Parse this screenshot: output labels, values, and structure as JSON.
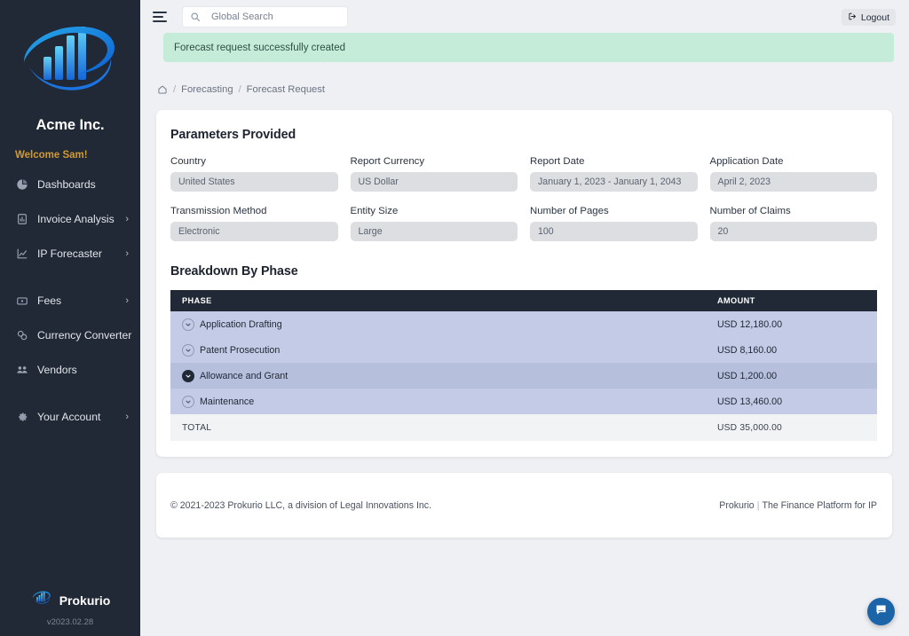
{
  "sidebar": {
    "company": "Acme Inc.",
    "welcome": "Welcome Sam!",
    "items": [
      {
        "label": "Dashboards",
        "icon": "pie-chart-icon",
        "chevron": ""
      },
      {
        "label": "Invoice Analysis",
        "icon": "document-chart-icon",
        "chevron": "›"
      },
      {
        "label": "IP Forecaster",
        "icon": "trend-chart-icon",
        "chevron": "›"
      },
      {
        "label": "Fees",
        "icon": "briefcase-icon",
        "chevron": "›"
      },
      {
        "label": "Currency Converter",
        "icon": "coins-icon",
        "chevron": ""
      },
      {
        "label": "Vendors",
        "icon": "people-icon",
        "chevron": ""
      },
      {
        "label": "Your Account",
        "icon": "gear-icon",
        "chevron": "›"
      }
    ],
    "footer_brand": "Prokurio",
    "version": "v2023.02.28"
  },
  "topbar": {
    "search_placeholder": "Global Search",
    "search_value": "",
    "logout_label": "Logout"
  },
  "alert": {
    "message": "Forecast request successfully created",
    "bg_color": "#c4ecd9"
  },
  "breadcrumb": {
    "home_icon": "home-icon",
    "sep": "/",
    "items": [
      "Forecasting",
      "Forecast Request"
    ]
  },
  "parameters": {
    "title": "Parameters Provided",
    "fields": [
      {
        "label": "Country",
        "value": "United States"
      },
      {
        "label": "Report Currency",
        "value": "US Dollar"
      },
      {
        "label": "Report Date",
        "value": "January 1, 2023 - January 1, 2043"
      },
      {
        "label": "Application Date",
        "value": "April 2, 2023"
      },
      {
        "label": "Transmission Method",
        "value": "Electronic"
      },
      {
        "label": "Entity Size",
        "value": "Large"
      },
      {
        "label": "Number of Pages",
        "value": "100"
      },
      {
        "label": "Number of Claims",
        "value": "20"
      }
    ]
  },
  "breakdown": {
    "title": "Breakdown By Phase",
    "columns": [
      "PHASE",
      "AMOUNT"
    ],
    "rows": [
      {
        "phase": "Application Drafting",
        "amount": "USD 12,180.00",
        "expanded": false,
        "hovered": false
      },
      {
        "phase": "Patent Prosecution",
        "amount": "USD 8,160.00",
        "expanded": false,
        "hovered": false
      },
      {
        "phase": "Allowance and Grant",
        "amount": "USD 1,200.00",
        "expanded": false,
        "hovered": true
      },
      {
        "phase": "Maintenance",
        "amount": "USD 13,460.00",
        "expanded": false,
        "hovered": false
      }
    ],
    "total_label": "TOTAL",
    "total_amount": "USD 35,000.00"
  },
  "footer": {
    "copyright": "© 2021-2023 Prokurio LLC, a division of Legal Innovations Inc.",
    "brand": "Prokurio",
    "pipe": "|",
    "tagline": "The Finance Platform for IP"
  },
  "chat": {
    "icon": "chat-bubble-icon"
  }
}
